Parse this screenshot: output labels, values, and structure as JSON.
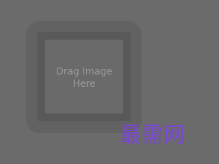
{
  "dropzone": {
    "line1": "Drag Image",
    "line2": "Here"
  },
  "watermark": {
    "text": "最需网",
    "color": "#7b45d8"
  },
  "colors": {
    "background": "#6b6b6b",
    "well": "#626262",
    "frame_border": "#595959",
    "text": "#9a9a9a"
  }
}
